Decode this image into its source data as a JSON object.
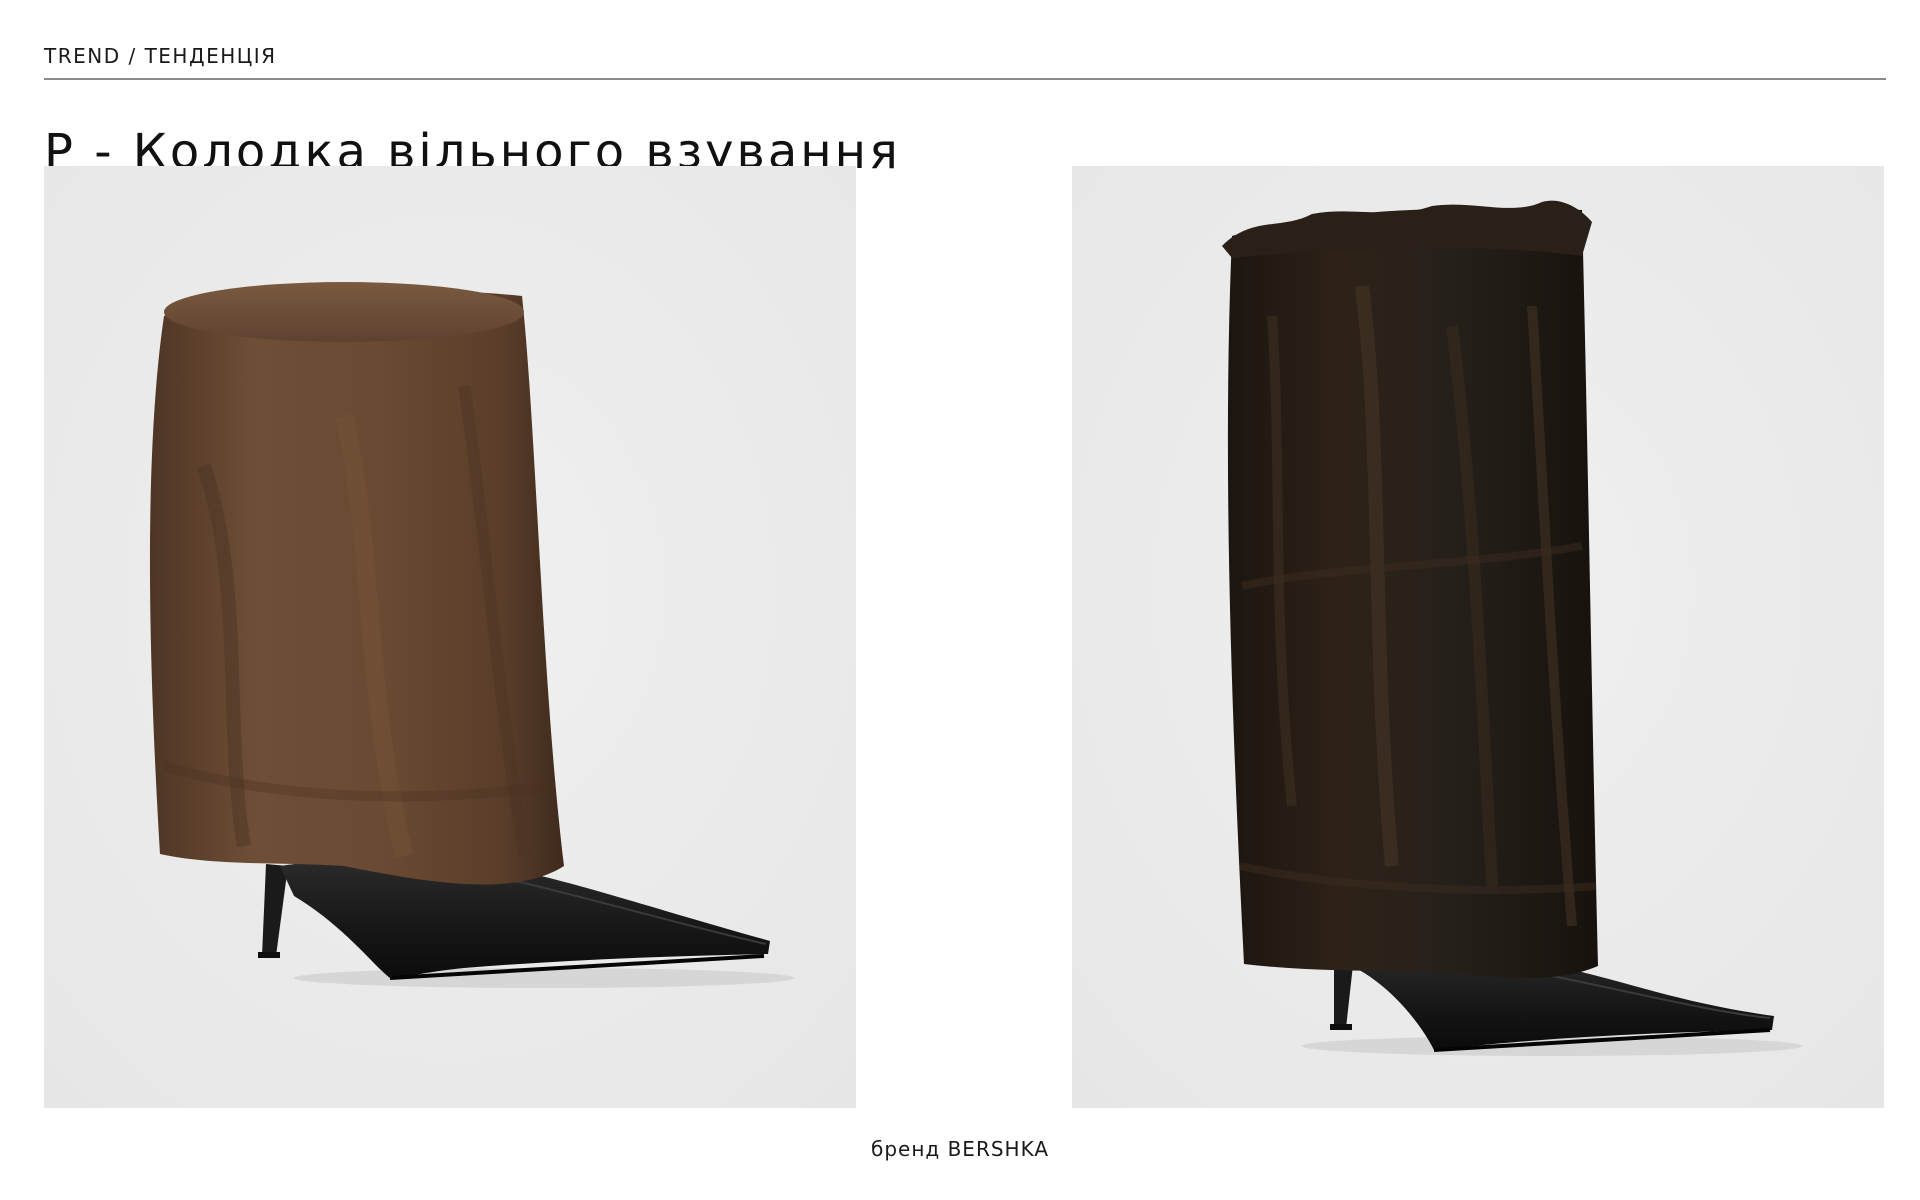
{
  "header": {
    "section_label": "TREND / ТЕНДЕНЦІЯ",
    "title": "P - Колодка вільного взування"
  },
  "products": [
    {
      "photo_subject": "fur-cuff-boot-brown"
    },
    {
      "photo_subject": "fur-cuff-boot-dark"
    }
  ],
  "footer": {
    "caption": "бренд BERSHKA"
  },
  "colors": {
    "divider": "#8a8a8a",
    "photo_background": "#ececec",
    "fur_light": "#6a4a33",
    "fur_dark": "#2a1f18",
    "leather": "#1c1c1c"
  }
}
